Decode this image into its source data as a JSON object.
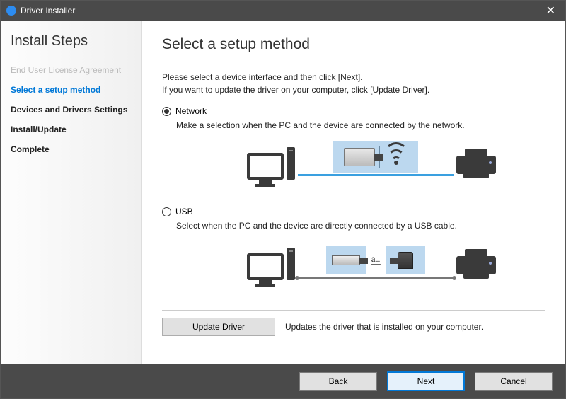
{
  "window": {
    "title": "Driver Installer"
  },
  "sidebar": {
    "title": "Install Steps",
    "steps": [
      {
        "label": "End User License Agreement",
        "state": "done"
      },
      {
        "label": "Select a setup method",
        "state": "active"
      },
      {
        "label": "Devices and Drivers Settings",
        "state": "pending"
      },
      {
        "label": "Install/Update",
        "state": "pending"
      },
      {
        "label": "Complete",
        "state": "pending"
      }
    ]
  },
  "main": {
    "title": "Select a setup method",
    "instruction_line1": "Please select a device interface and then click [Next].",
    "instruction_line2": "If you want to update the driver on your computer, click [Update Driver].",
    "options": {
      "network": {
        "label": "Network",
        "selected": true,
        "description": "Make a selection when the PC and the device are connected by the network."
      },
      "usb": {
        "label": "USB",
        "selected": false,
        "description": "Select when the PC and the device are directly connected by a USB cable."
      }
    },
    "update": {
      "button": "Update Driver",
      "description": "Updates the driver that is installed on your computer."
    }
  },
  "footer": {
    "back": "Back",
    "next": "Next",
    "cancel": "Cancel"
  }
}
